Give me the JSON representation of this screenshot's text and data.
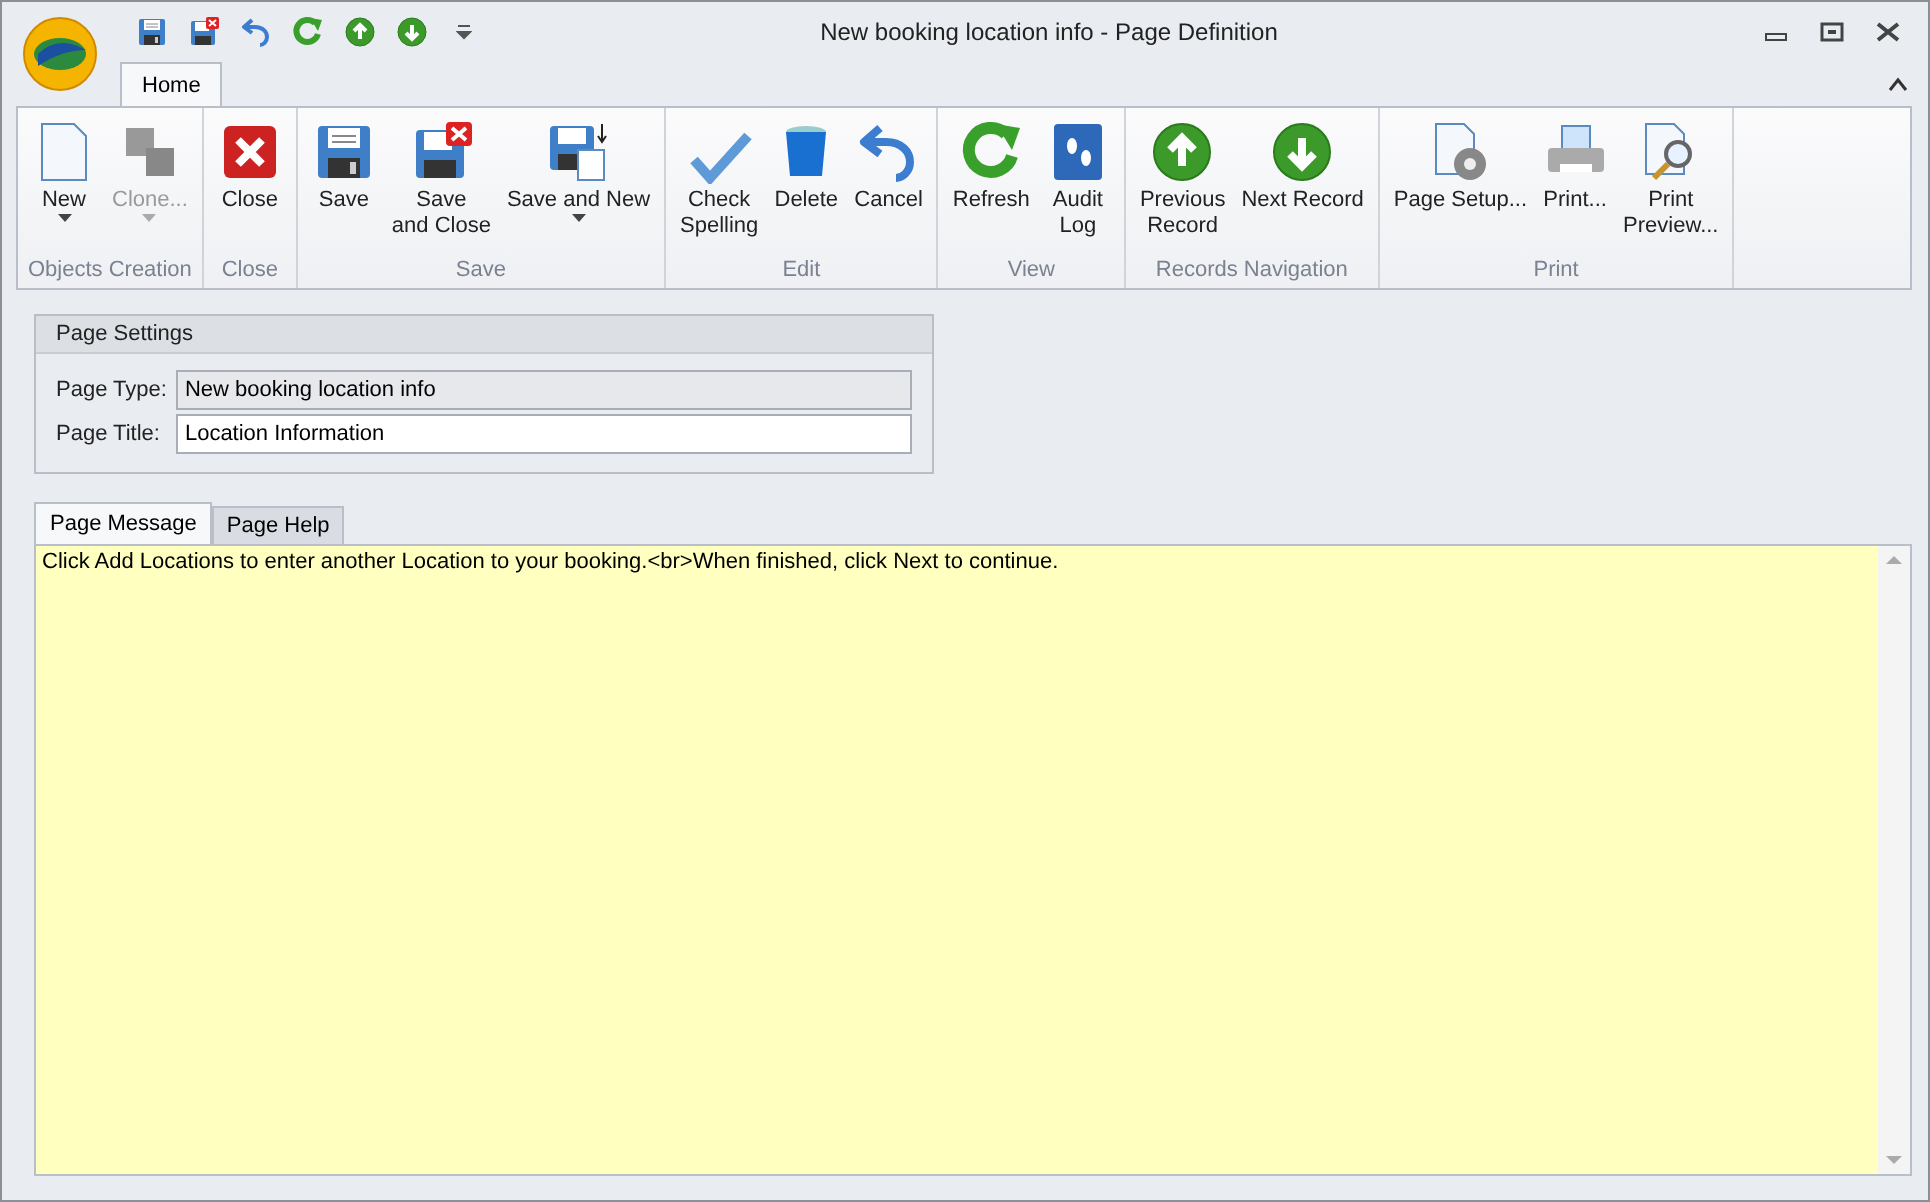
{
  "window": {
    "title": "New booking location info - Page Definition"
  },
  "quick_access": [
    {
      "kind": "save"
    },
    {
      "kind": "save-close"
    },
    {
      "kind": "undo"
    },
    {
      "kind": "refresh"
    },
    {
      "kind": "up"
    },
    {
      "kind": "down"
    },
    {
      "kind": "customize"
    }
  ],
  "ribbon_tabs": [
    {
      "label": "Home",
      "selected": true
    }
  ],
  "ribbon_groups": [
    {
      "label": "Objects Creation",
      "buttons": [
        {
          "kind": "new",
          "label": "New",
          "dropdown": true,
          "disabled": false
        },
        {
          "kind": "clone",
          "label": "Clone...",
          "dropdown": true,
          "disabled": true
        }
      ]
    },
    {
      "label": "Close",
      "buttons": [
        {
          "kind": "close",
          "label": "Close",
          "dropdown": false,
          "disabled": false
        }
      ]
    },
    {
      "label": "Save",
      "buttons": [
        {
          "kind": "save",
          "label": "Save",
          "dropdown": false,
          "disabled": false
        },
        {
          "kind": "save-close",
          "label": "Save and Close",
          "dropdown": false,
          "disabled": false
        },
        {
          "kind": "save-new",
          "label": "Save and New",
          "dropdown": true,
          "disabled": false
        }
      ]
    },
    {
      "label": "Edit",
      "buttons": [
        {
          "kind": "spell",
          "label": "Check Spelling",
          "dropdown": false,
          "disabled": false
        },
        {
          "kind": "delete",
          "label": "Delete",
          "dropdown": false,
          "disabled": false
        },
        {
          "kind": "undo",
          "label": "Cancel",
          "dropdown": false,
          "disabled": false
        }
      ]
    },
    {
      "label": "View",
      "buttons": [
        {
          "kind": "refresh",
          "label": "Refresh",
          "dropdown": false,
          "disabled": false
        },
        {
          "kind": "log",
          "label": "Audit Log",
          "dropdown": false,
          "disabled": false
        }
      ]
    },
    {
      "label": "Records Navigation",
      "buttons": [
        {
          "kind": "up",
          "label": "Previous Record",
          "dropdown": false,
          "disabled": false
        },
        {
          "kind": "down",
          "label": "Next Record",
          "dropdown": false,
          "disabled": false
        }
      ]
    },
    {
      "label": "Print",
      "buttons": [
        {
          "kind": "page-setup",
          "label": "Page Setup...",
          "dropdown": false,
          "disabled": false
        },
        {
          "kind": "print",
          "label": "Print...",
          "dropdown": false,
          "disabled": false
        },
        {
          "kind": "preview",
          "label": "Print Preview...",
          "dropdown": false,
          "disabled": false
        }
      ]
    }
  ],
  "page_settings": {
    "title": "Page Settings",
    "fields": [
      {
        "label": "Page Type:",
        "value": "New booking location info",
        "disabled": true
      },
      {
        "label": "Page Title:",
        "value": "Location Information",
        "disabled": false
      }
    ]
  },
  "content_tabs": [
    {
      "label": "Page Message",
      "selected": true
    },
    {
      "label": "Page Help",
      "selected": false
    }
  ],
  "message": {
    "value": "Click Add Locations to enter another Location to your booking.<br>When finished, click Next to continue."
  }
}
